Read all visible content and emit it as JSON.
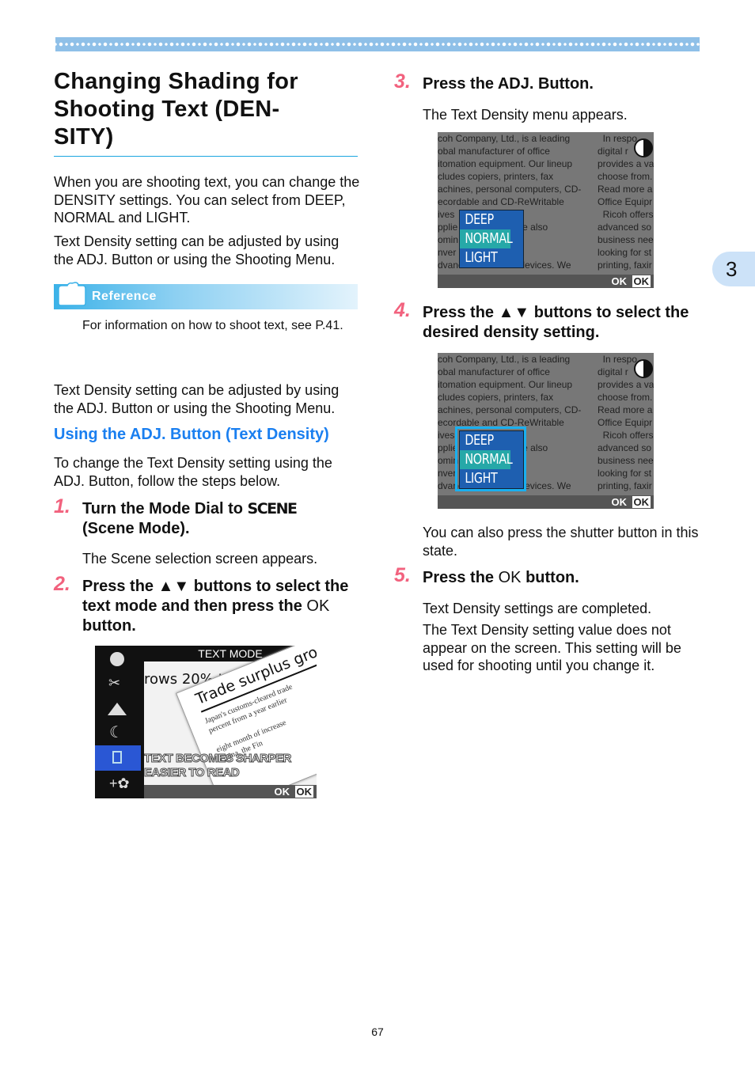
{
  "header_band": {
    "decoration": "diamond-pattern"
  },
  "title": "Changing Shading for Shooting Text (DEN-SITY)",
  "title_lines": [
    "Changing Shading for",
    "Shooting Text (DEN-",
    "SITY)"
  ],
  "intro": [
    "When you are shooting text, you can change the DENSITY settings. You can select from DEEP, NORMAL and LIGHT.",
    "Text Density setting can be adjusted by using the ADJ. Button or using the Shooting Menu."
  ],
  "reference": {
    "label": "Reference",
    "icon": "folder-icon",
    "text": "For information on how to shoot text, see P.41."
  },
  "repeat_paragraph": "Text Density setting can be adjusted by using the ADJ. Button or using the Shooting Menu.",
  "section": {
    "heading": "Using the ADJ. Button (Text Density)",
    "intro": "To change the Text Density setting using the ADJ. Button, follow the steps below."
  },
  "steps": [
    {
      "number": "1.",
      "title_a": "Turn the Mode Dial to ",
      "title_sym": "SCENE",
      "title_b": "(Scene Mode).",
      "body": "The Scene selection screen appears."
    },
    {
      "number": "2.",
      "title_a": "Press the ",
      "title_sym": "▲▼",
      "title_b": " buttons to select the text mode and then press the ",
      "title_ok": "OK",
      "title_c": " button."
    },
    {
      "number": "3.",
      "title": "Press the ADJ. Button.",
      "body": "The Text Density menu appears."
    },
    {
      "number": "4.",
      "title_a": "Press the ",
      "title_sym": "▲▼",
      "title_b": " buttons to select the desired density setting.",
      "body": "You can also press the shutter button in this state."
    },
    {
      "number": "5.",
      "title_a": "Press the ",
      "title_ok": "OK",
      "title_b": " button.",
      "body": [
        "Text Density settings are completed.",
        "The Text Density setting value does not appear on the screen. This setting will be used for shooting until you change it."
      ]
    }
  ],
  "screen_scene": {
    "header": "TEXT MODE",
    "caption_lines": [
      "TEXT BECOMES SHARPER",
      "EASIER TO READ"
    ],
    "headline_left": "rows 20% t",
    "headline_right": "Trade surplus gro",
    "ok_plain": "OK",
    "ok_box": "OK",
    "scene_icons": [
      "portrait-icon",
      "sports-icon",
      "landscape-icon",
      "night-icon",
      "text-mode-icon",
      "high-sensitivity-icon"
    ],
    "selected_index": 4
  },
  "screen_density": {
    "bg_text_left": "coh Company, Ltd., is a leading\nobal manufacturer of office\nitomation equipment. Our lineup\ncludes copiers, printers, fax\nachines, personal computers, CD-\necordable and CD-ReWritable\nives              related\npplie             . We are also\nomin              d\nnver              and\ndvanced electronic devices. We",
    "bg_text_right": "  In respo\ndigital r\nprovides a va\nchoose from.\nRead more a\nOffice Equipr\n  Ricoh offers\nadvanced so\nbusiness nee\nlooking for st\nprinting, faxir",
    "options": [
      "DEEP",
      "NORMAL",
      "LIGHT"
    ],
    "selected": "NORMAL",
    "ok_plain": "OK",
    "ok_box": "OK"
  },
  "chapter_tab": "3",
  "page_number": "67",
  "colors": {
    "accent_blue": "#1a7ff0",
    "step_pink": "#f2627e",
    "rule_blue": "#1aa6e0",
    "band_blue": "#8fc0e8",
    "menu_blue": "#1e5fb0",
    "menu_selected": "#26a8a8"
  }
}
